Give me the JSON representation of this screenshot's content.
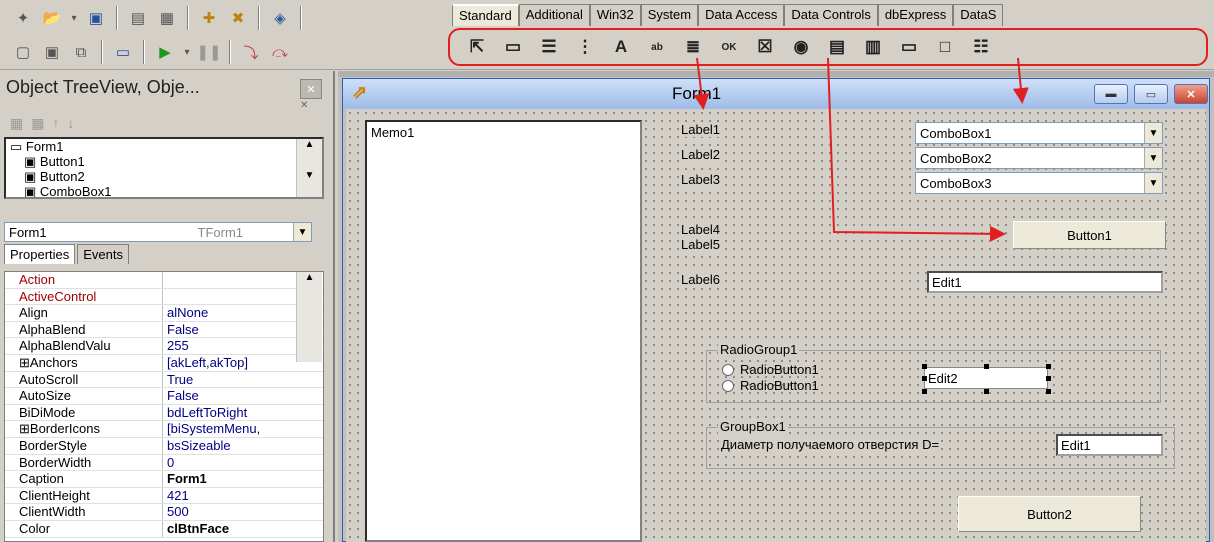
{
  "palette_tabs": [
    "Standard",
    "Additional",
    "Win32",
    "System",
    "Data Access",
    "Data Controls",
    "dbExpress",
    "DataS"
  ],
  "palette_items": [
    {
      "name": "pointer-icon",
      "glyph": "⇱"
    },
    {
      "name": "frame-icon",
      "glyph": "▭"
    },
    {
      "name": "mainmenu-icon",
      "glyph": "☰"
    },
    {
      "name": "popupmenu-icon",
      "glyph": "⋮"
    },
    {
      "name": "label-icon",
      "glyph": "A"
    },
    {
      "name": "edit-icon",
      "glyph": "ab"
    },
    {
      "name": "memo-icon",
      "glyph": "≣"
    },
    {
      "name": "button-icon",
      "glyph": "OK"
    },
    {
      "name": "checkbox-icon",
      "glyph": "☒"
    },
    {
      "name": "radiobutton-icon",
      "glyph": "◉"
    },
    {
      "name": "listbox-icon",
      "glyph": "▤"
    },
    {
      "name": "combobox-icon",
      "glyph": "▥"
    },
    {
      "name": "scrollbar-icon",
      "glyph": "▭"
    },
    {
      "name": "groupbox-icon",
      "glyph": "□"
    },
    {
      "name": "radiogroup-icon",
      "glyph": "☷"
    }
  ],
  "left_panel": {
    "title": "Object TreeView, Obje...",
    "tree": [
      "Form1",
      "Button1",
      "Button2",
      "ComboBox1"
    ],
    "object_selector": {
      "name": "Form1",
      "type": "TForm1"
    },
    "tabs": [
      "Properties",
      "Events"
    ],
    "properties": [
      {
        "name": "Action",
        "value": "",
        "red": true
      },
      {
        "name": "ActiveControl",
        "value": "",
        "red": true
      },
      {
        "name": "Align",
        "value": "alNone"
      },
      {
        "name": "AlphaBlend",
        "value": "False"
      },
      {
        "name": "AlphaBlendValu",
        "value": "255"
      },
      {
        "name": "⊞Anchors",
        "value": "[akLeft,akTop]"
      },
      {
        "name": "AutoScroll",
        "value": "True"
      },
      {
        "name": "AutoSize",
        "value": "False"
      },
      {
        "name": "BiDiMode",
        "value": "bdLeftToRight"
      },
      {
        "name": "⊞BorderIcons",
        "value": "[biSystemMenu,"
      },
      {
        "name": "BorderStyle",
        "value": "bsSizeable"
      },
      {
        "name": "BorderWidth",
        "value": "0"
      },
      {
        "name": "Caption",
        "value": "Form1",
        "bold": true
      },
      {
        "name": "ClientHeight",
        "value": "421"
      },
      {
        "name": "ClientWidth",
        "value": "500"
      },
      {
        "name": "Color",
        "value": "clBtnFace",
        "bold": true
      }
    ]
  },
  "form": {
    "title": "Form1",
    "memo": "Memo1",
    "labels": [
      "Label1",
      "Label2",
      "Label3",
      "Label4",
      "Label5",
      "Label6"
    ],
    "combos": [
      "ComboBox1",
      "ComboBox2",
      "ComboBox3"
    ],
    "button1": "Button1",
    "button2": "Button2",
    "edit1": "Edit1",
    "edit2": "Edit2",
    "radiogroup_caption": "RadioGroup1",
    "radio1": "RadioButton1",
    "radio2": "RadioButton1",
    "groupbox_caption": "GroupBox1",
    "groupbox_label": "Диаметр получаемого отверстия D=",
    "groupbox_edit": "Edit1"
  }
}
